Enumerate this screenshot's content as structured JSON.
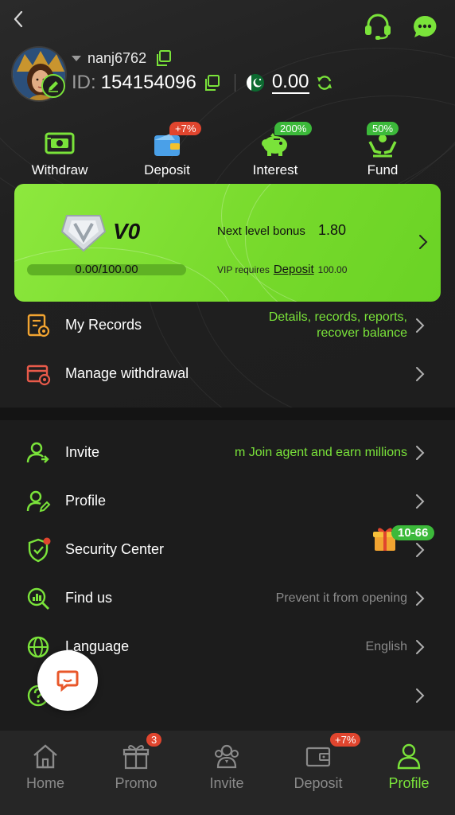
{
  "header": {
    "username": "nanj6762",
    "id_label": "ID:",
    "id_value": "154154096",
    "balance": "0.00"
  },
  "quick_actions": [
    {
      "label": "Withdraw",
      "badge": "",
      "icon": "withdraw-icon"
    },
    {
      "label": "Deposit",
      "badge": "+7%",
      "icon": "wallet-icon"
    },
    {
      "label": "Interest",
      "badge": "200%",
      "icon": "piggy-bank-icon"
    },
    {
      "label": "Fund",
      "badge": "50%",
      "icon": "fund-hands-icon"
    }
  ],
  "vip": {
    "level": "V0",
    "progress_text": "0.00/100.00",
    "progress_fraction": 0.0,
    "next_bonus_label": "Next level bonus",
    "next_bonus_value": "1.80",
    "requires_label": "VIP requires",
    "requires_link": "Deposit",
    "requires_amount": "100.00"
  },
  "menu_top": [
    {
      "label": "My Records",
      "hint": "Details, records, reports, recover balance",
      "icon": "records-icon"
    },
    {
      "label": "Manage withdrawal",
      "hint": "",
      "icon": "manage-withdrawal-icon"
    }
  ],
  "menu_main": [
    {
      "label": "Invite",
      "hint": "m  Join agent and earn millions",
      "icon": "invite-icon"
    },
    {
      "label": "Profile",
      "hint": "",
      "icon": "profile-edit-icon"
    },
    {
      "label": "Security Center",
      "hint": "",
      "badge": "10-66",
      "icon": "shield-icon"
    },
    {
      "label": "Find us",
      "hint": "Prevent it from opening",
      "icon": "find-us-icon"
    },
    {
      "label": "Language",
      "hint": "English",
      "icon": "globe-icon"
    },
    {
      "label": "",
      "hint": "",
      "icon": "help-icon"
    }
  ],
  "tabbar": [
    {
      "label": "Home",
      "badge": "",
      "icon": "home-icon"
    },
    {
      "label": "Promo",
      "badge": "3",
      "icon": "gift-icon"
    },
    {
      "label": "Invite",
      "badge": "",
      "icon": "people-icon"
    },
    {
      "label": "Deposit",
      "badge": "+7%",
      "icon": "wallet-icon"
    },
    {
      "label": "Profile",
      "badge": "",
      "icon": "person-icon"
    }
  ],
  "colors": {
    "accent": "#7ae33a",
    "badge_red": "#e0452e",
    "badge_green": "#3cb93a",
    "background": "#1c1c1c"
  }
}
